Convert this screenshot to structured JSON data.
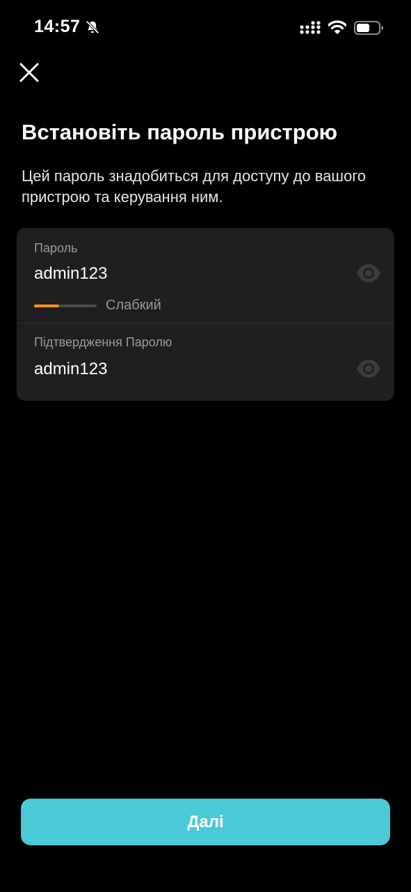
{
  "status_bar": {
    "time": "14:57",
    "icons": [
      "bell-slash-icon",
      "cellular-signal-icon",
      "wifi-icon",
      "battery-icon"
    ]
  },
  "header": {
    "close_icon": "close-icon",
    "title": "Встановіть пароль пристрою",
    "subtitle": "Цей пароль знадобиться для доступу до вашого пристрою та керування ним."
  },
  "form": {
    "password": {
      "label": "Пароль",
      "value": "admin123",
      "toggle_icon": "eye-icon",
      "strength": {
        "label": "Слабкий",
        "level": 0.4,
        "color": "#f7941d"
      }
    },
    "confirm": {
      "label": "Підтвердження Паролю",
      "value": "admin123",
      "toggle_icon": "eye-icon"
    }
  },
  "footer": {
    "next_label": "Далі"
  },
  "colors": {
    "background": "#000000",
    "card": "#1f1f21",
    "accent": "#4cc9d6",
    "strength_weak": "#f7941d"
  }
}
